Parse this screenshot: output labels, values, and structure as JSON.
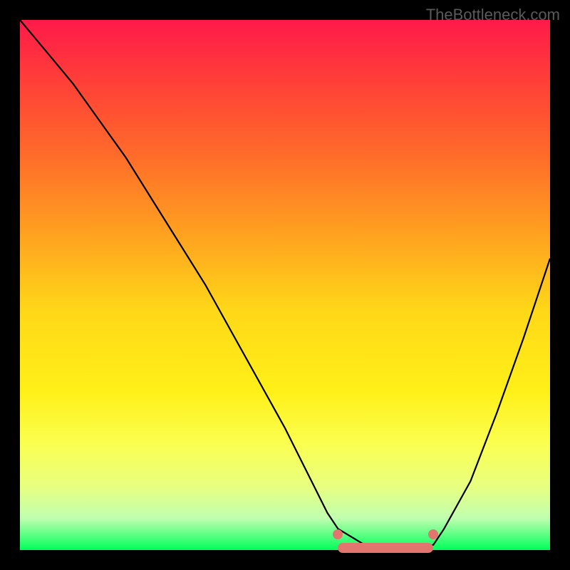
{
  "watermark": "TheBottleneck.com",
  "chart_data": {
    "type": "line",
    "title": "",
    "xlabel": "",
    "ylabel": "",
    "xlim": [
      0,
      100
    ],
    "ylim": [
      0,
      100
    ],
    "series": [
      {
        "name": "curve",
        "x": [
          0,
          5,
          10,
          15,
          20,
          25,
          30,
          35,
          40,
          45,
          50,
          55,
          58,
          60,
          65,
          70,
          75,
          78,
          80,
          85,
          90,
          95,
          100
        ],
        "y": [
          100,
          94,
          88,
          81,
          74,
          66,
          58,
          50,
          41,
          32,
          23,
          13,
          7,
          4,
          1,
          0,
          0,
          1,
          4,
          13,
          26,
          40,
          55
        ]
      }
    ],
    "optimal_zone": {
      "x_start": 60,
      "x_end": 78,
      "y": 0
    },
    "optimal_markers": [
      {
        "x": 60,
        "y": 3
      },
      {
        "x": 78,
        "y": 3
      }
    ],
    "gradient_stops": [
      {
        "pos": 0,
        "color": "#ff1a4a"
      },
      {
        "pos": 25,
        "color": "#ff6a2a"
      },
      {
        "pos": 55,
        "color": "#ffd818"
      },
      {
        "pos": 80,
        "color": "#faff50"
      },
      {
        "pos": 100,
        "color": "#00ff5a"
      }
    ]
  }
}
